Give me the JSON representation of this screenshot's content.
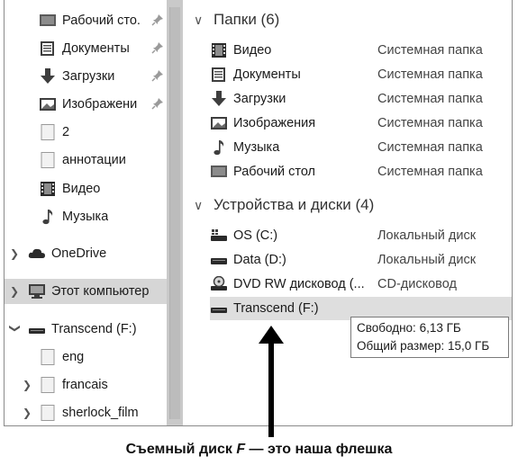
{
  "navigation": {
    "quick_access": [
      {
        "label": "Рабочий сто.",
        "icon": "desktop-icon",
        "pinned": true
      },
      {
        "label": "Документы",
        "icon": "documents-icon",
        "pinned": true
      },
      {
        "label": "Загрузки",
        "icon": "downloads-icon",
        "pinned": true
      },
      {
        "label": "Изображени",
        "icon": "pictures-icon",
        "pinned": true
      },
      {
        "label": "2",
        "icon": "folder-icon",
        "pinned": false
      },
      {
        "label": "аннотации",
        "icon": "folder-icon",
        "pinned": false
      },
      {
        "label": "Видео",
        "icon": "video-icon",
        "pinned": false
      },
      {
        "label": "Музыка",
        "icon": "music-icon",
        "pinned": false
      }
    ],
    "onedrive": {
      "label": "OneDrive",
      "icon": "cloud-icon"
    },
    "this_pc": {
      "label": "Этот компьютер",
      "icon": "computer-icon"
    },
    "drive": {
      "label": "Transcend (F:)",
      "icon": "usb-drive-icon"
    },
    "drive_children": [
      {
        "label": "eng",
        "icon": "folder-icon",
        "expandable": false
      },
      {
        "label": "francais",
        "icon": "folder-icon",
        "expandable": true
      },
      {
        "label": "sherlock_film",
        "icon": "folder-icon",
        "expandable": true
      }
    ]
  },
  "content": {
    "folders_group": {
      "label": "Папки (6)"
    },
    "folders": [
      {
        "name": "Видео",
        "type": "Системная папка",
        "icon": "video-icon"
      },
      {
        "name": "Документы",
        "type": "Системная папка",
        "icon": "documents-icon"
      },
      {
        "name": "Загрузки",
        "type": "Системная папка",
        "icon": "downloads-icon"
      },
      {
        "name": "Изображения",
        "type": "Системная папка",
        "icon": "pictures-icon"
      },
      {
        "name": "Музыка",
        "type": "Системная папка",
        "icon": "music-icon"
      },
      {
        "name": "Рабочий стол",
        "type": "Системная папка",
        "icon": "desktop-icon"
      }
    ],
    "devices_group": {
      "label": "Устройства и диски (4)"
    },
    "devices": [
      {
        "name": "OS (C:)",
        "type": "Локальный диск",
        "icon": "system-drive-icon"
      },
      {
        "name": "Data (D:)",
        "type": "Локальный диск",
        "icon": "hard-drive-icon"
      },
      {
        "name": "DVD RW дисковод (...",
        "type": "CD-дисковод",
        "icon": "dvd-drive-icon"
      },
      {
        "name": "Transcend (F:)",
        "type": "",
        "icon": "usb-drive-icon"
      }
    ],
    "tooltip": {
      "free": "Свободно: 6,13 ГБ",
      "total": "Общий размер: 15,0 ГБ"
    }
  },
  "caption": {
    "before": "Съемный диск ",
    "italic": "F",
    "after": " — это наша флешка"
  }
}
